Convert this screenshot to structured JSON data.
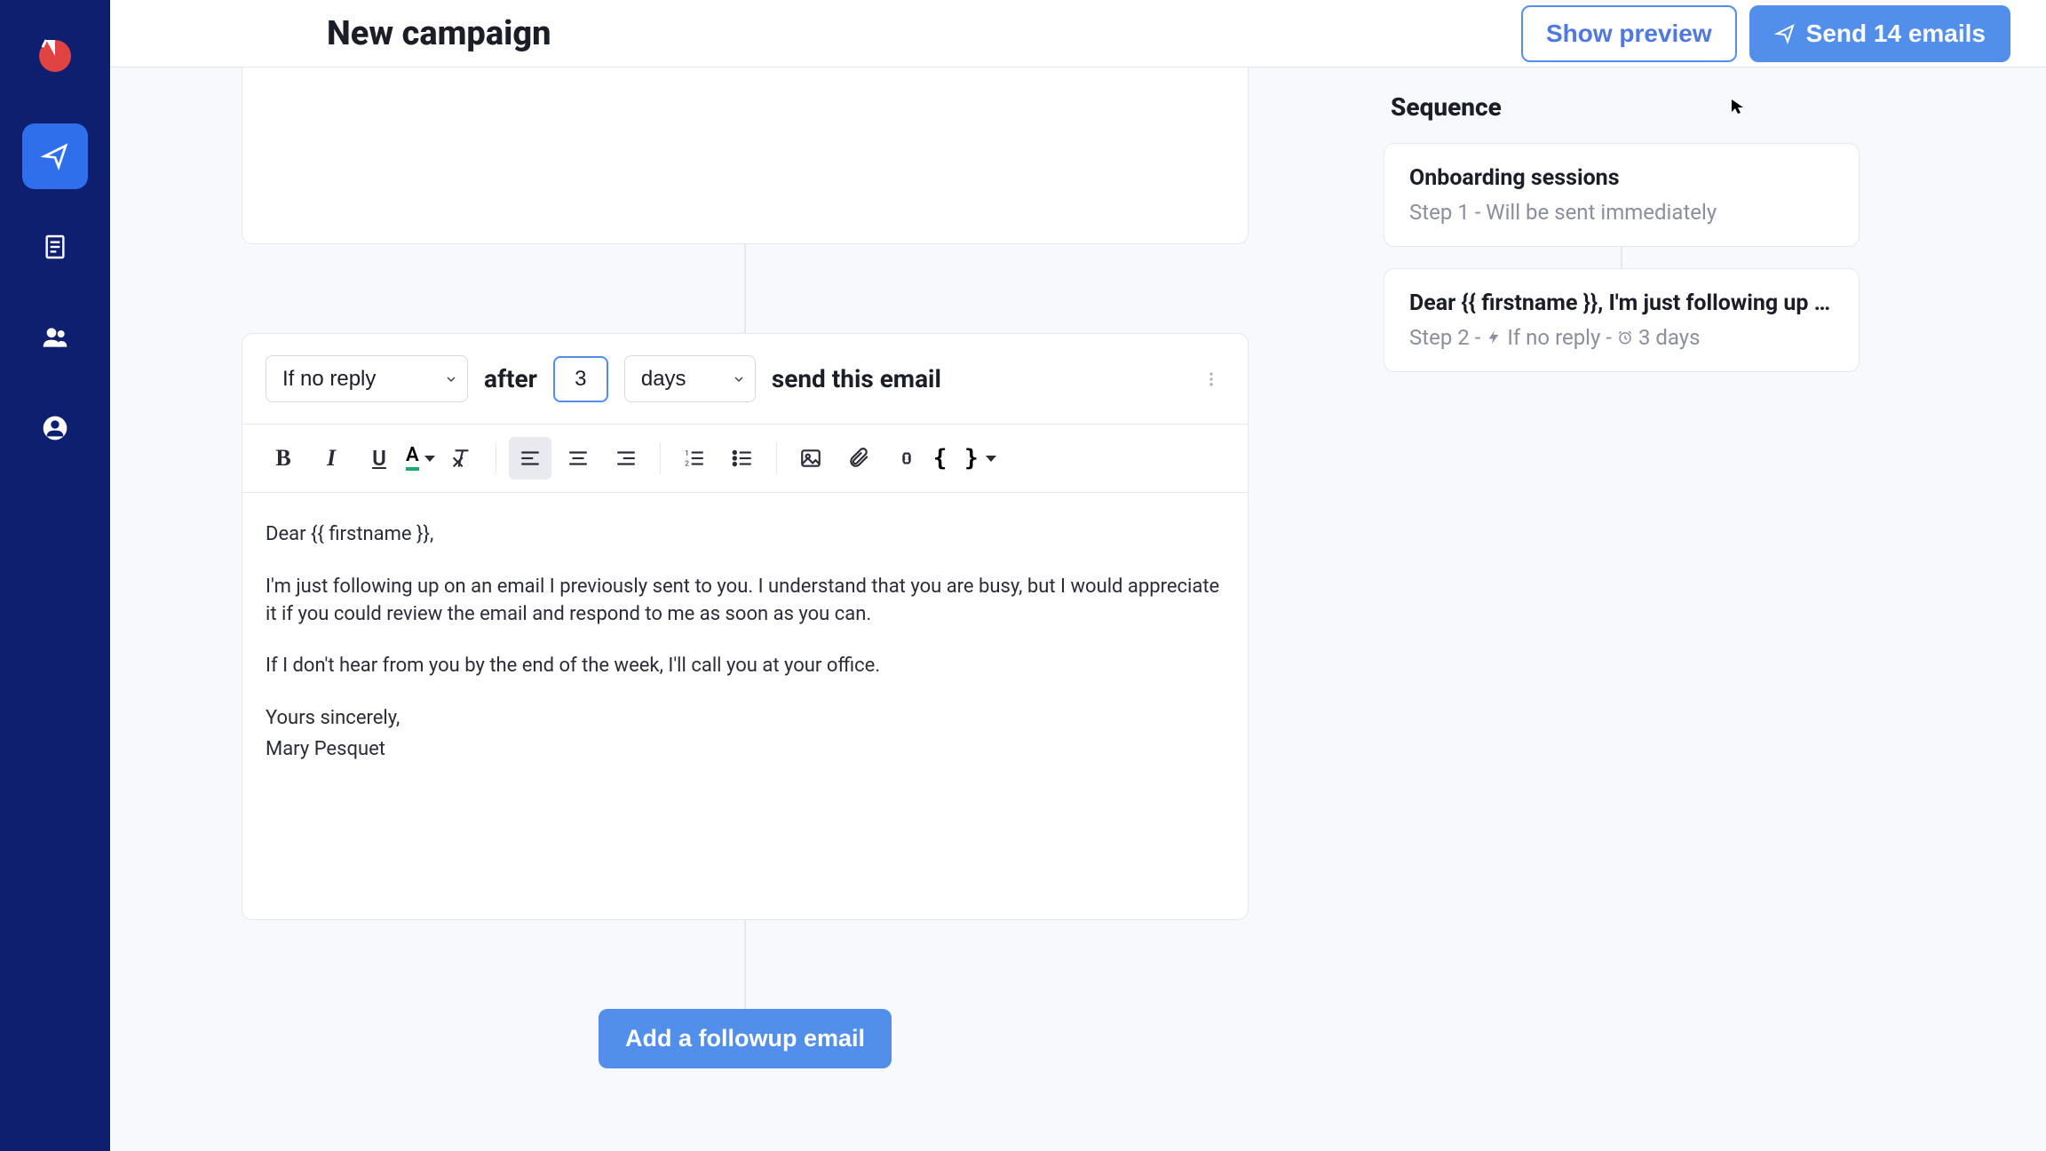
{
  "header": {
    "title": "New campaign",
    "preview_label": "Show preview",
    "send_label": "Send 14 emails"
  },
  "condition": {
    "trigger_select": "If no reply",
    "after_label": "after",
    "num_value": "3",
    "unit_select": "days",
    "action_label": "send this email"
  },
  "email_body": {
    "line1": "Dear {{ firstname }},",
    "para1": "I'm just following up on an email I previously sent to you. I understand that you are busy, but I would appreciate it if you could review the email and respond to me as soon as you can.",
    "para2": "If I don't hear from you by the end of the week, I'll call you at your office.",
    "signoff": "Yours sincerely,",
    "signature": "Mary Pesquet"
  },
  "add_followup_label": "Add a followup email",
  "sequence": {
    "title": "Sequence",
    "items": [
      {
        "title": "Onboarding sessions",
        "subtitle": "Step 1 - Will be sent immediately"
      },
      {
        "title": "Dear {{ firstname }}, I'm just following up …",
        "step": "Step 2 -",
        "cond": "If no reply -",
        "time": "3 days"
      }
    ]
  }
}
